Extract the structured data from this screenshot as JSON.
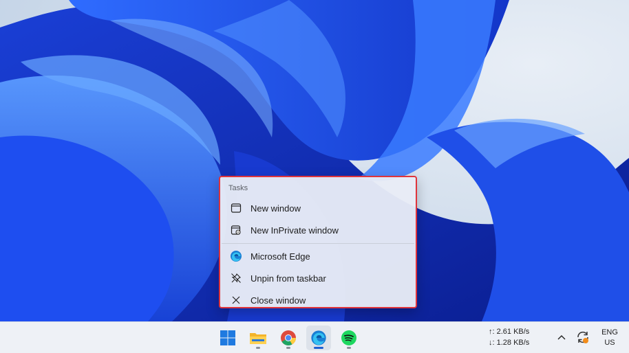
{
  "jumplist": {
    "heading": "Tasks",
    "items": [
      {
        "label": "New window",
        "icon": "window-icon"
      },
      {
        "label": "New InPrivate window",
        "icon": "inprivate-window-icon"
      },
      {
        "label": "Microsoft Edge",
        "icon": "edge-icon"
      },
      {
        "label": "Unpin from taskbar",
        "icon": "unpin-icon"
      },
      {
        "label": "Close window",
        "icon": "close-icon"
      }
    ],
    "highlight_color": "#e0343b"
  },
  "taskbar": {
    "apps": [
      {
        "name": "Start",
        "icon": "windows-logo-icon"
      },
      {
        "name": "File Explorer",
        "icon": "folder-icon"
      },
      {
        "name": "Google Chrome",
        "icon": "chrome-icon"
      },
      {
        "name": "Microsoft Edge",
        "icon": "edge-icon"
      },
      {
        "name": "Spotify",
        "icon": "spotify-icon"
      }
    ],
    "network": {
      "upload": "↑: 2.61 KB/s",
      "download": "↓: 1.28 KB/s"
    },
    "language": {
      "line1": "ENG",
      "line2": "US"
    }
  }
}
